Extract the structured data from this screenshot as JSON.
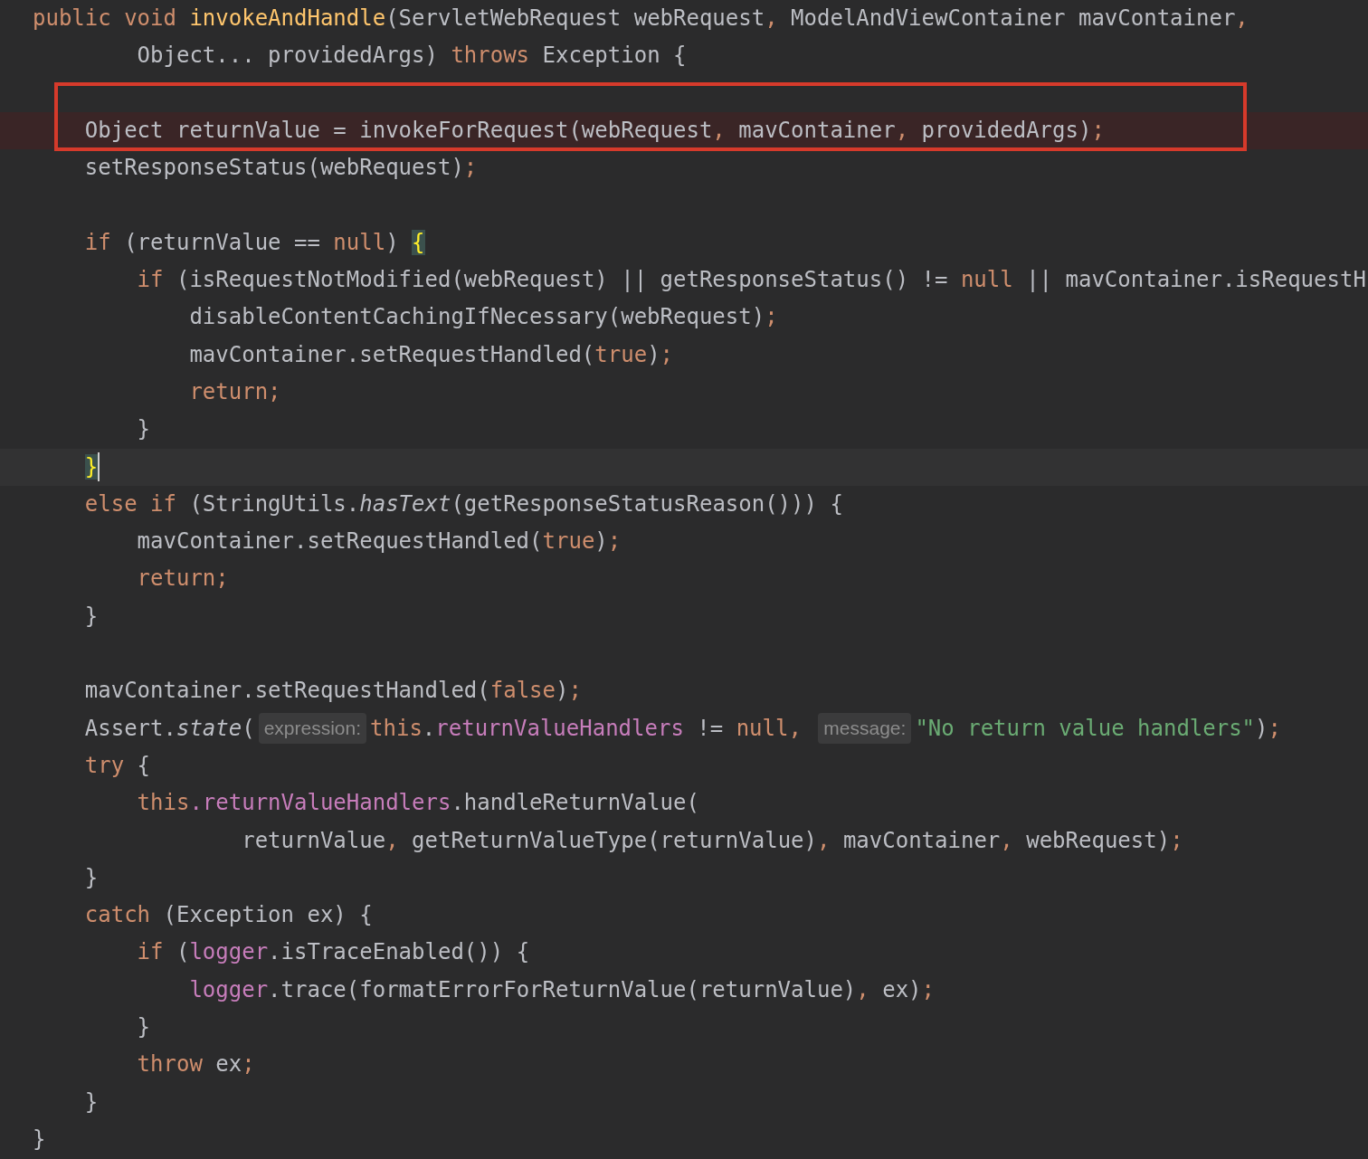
{
  "editor": {
    "lines": [
      {
        "kind": "code",
        "tokens": [
          {
            "kind": "kw",
            "text": "public void "
          },
          {
            "kind": "fn",
            "text": "invokeAndHandle"
          },
          {
            "kind": "plain",
            "text": "(ServletWebRequest webRequest"
          },
          {
            "kind": "punct",
            "text": ", "
          },
          {
            "kind": "plain",
            "text": "ModelAndViewContainer mavContainer"
          },
          {
            "kind": "punct",
            "text": ","
          }
        ],
        "children": [
          {
            "kind": "continuation",
            "tokens": [
              {
                "kind": "plain",
                "text": "Object... providedArgs) "
              },
              {
                "kind": "kw",
                "text": "throws "
              },
              {
                "kind": "plain",
                "text": "Exception {"
              }
            ]
          },
          {
            "kind": "blank",
            "boxed": true
          },
          {
            "kind": "code",
            "boxed": true,
            "breakpoint": true,
            "tokens": [
              {
                "kind": "plain",
                "text": "Object returnValue = invokeForRequest(webRequest"
              },
              {
                "kind": "punct",
                "text": ", "
              },
              {
                "kind": "plain",
                "text": "mavContainer"
              },
              {
                "kind": "punct",
                "text": ", "
              },
              {
                "kind": "plain",
                "text": "providedArgs)"
              },
              {
                "kind": "punct",
                "text": ";"
              }
            ]
          },
          {
            "kind": "code",
            "tokens": [
              {
                "kind": "plain",
                "text": "setResponseStatus(webRequest)"
              },
              {
                "kind": "punct",
                "text": ";"
              }
            ]
          },
          {
            "kind": "blank"
          },
          {
            "kind": "code",
            "tokens": [
              {
                "kind": "kw",
                "text": "if "
              },
              {
                "kind": "plain",
                "text": "(returnValue == "
              },
              {
                "kind": "kw",
                "text": "null"
              },
              {
                "kind": "plain",
                "text": ") "
              },
              {
                "kind": "brace",
                "text": "{"
              }
            ],
            "children": [
              {
                "kind": "code",
                "tokens": [
                  {
                    "kind": "kw",
                    "text": "if "
                  },
                  {
                    "kind": "plain",
                    "text": "(isRequestNotModified(webRequest) || getResponseStatus() != "
                  },
                  {
                    "kind": "kw",
                    "text": "null"
                  },
                  {
                    "kind": "plain",
                    "text": " || mavContainer.isRequestH"
                  }
                ],
                "children": [
                  {
                    "kind": "code",
                    "tokens": [
                      {
                        "kind": "plain",
                        "text": "disableContentCachingIfNecessary(webRequest)"
                      },
                      {
                        "kind": "punct",
                        "text": ";"
                      }
                    ]
                  },
                  {
                    "kind": "code",
                    "tokens": [
                      {
                        "kind": "plain",
                        "text": "mavContainer.setRequestHandled("
                      },
                      {
                        "kind": "kw",
                        "text": "true"
                      },
                      {
                        "kind": "plain",
                        "text": ")"
                      },
                      {
                        "kind": "punct",
                        "text": ";"
                      }
                    ]
                  },
                  {
                    "kind": "code",
                    "tokens": [
                      {
                        "kind": "kw",
                        "text": "return;"
                      }
                    ]
                  }
                ]
              },
              {
                "kind": "code",
                "tokens": [
                  {
                    "kind": "plain",
                    "text": "}"
                  }
                ]
              }
            ]
          },
          {
            "kind": "code",
            "current_line": true,
            "caret": true,
            "tokens": [
              {
                "kind": "brace",
                "text": "}"
              }
            ]
          },
          {
            "kind": "code",
            "tokens": [
              {
                "kind": "kw",
                "text": "else if "
              },
              {
                "kind": "plain",
                "text": "(StringUtils."
              },
              {
                "kind": "italic",
                "text": "hasText"
              },
              {
                "kind": "plain",
                "text": "(getResponseStatusReason())) {"
              }
            ],
            "children": [
              {
                "kind": "code",
                "tokens": [
                  {
                    "kind": "plain",
                    "text": "mavContainer.setRequestHandled("
                  },
                  {
                    "kind": "kw",
                    "text": "true"
                  },
                  {
                    "kind": "plain",
                    "text": ")"
                  },
                  {
                    "kind": "punct",
                    "text": ";"
                  }
                ]
              },
              {
                "kind": "code",
                "tokens": [
                  {
                    "kind": "kw",
                    "text": "return;"
                  }
                ]
              }
            ]
          },
          {
            "kind": "code",
            "tokens": [
              {
                "kind": "plain",
                "text": "}"
              }
            ]
          },
          {
            "kind": "blank"
          },
          {
            "kind": "code",
            "tokens": [
              {
                "kind": "plain",
                "text": "mavContainer.setRequestHandled("
              },
              {
                "kind": "kw",
                "text": "false"
              },
              {
                "kind": "plain",
                "text": ")"
              },
              {
                "kind": "punct",
                "text": ";"
              }
            ]
          },
          {
            "kind": "code",
            "tokens": [
              {
                "kind": "plain",
                "text": "Assert."
              },
              {
                "kind": "italic",
                "text": "state"
              },
              {
                "kind": "plain",
                "text": "("
              },
              {
                "kind": "hint",
                "text": "expression:"
              },
              {
                "kind": "kw",
                "text": "this"
              },
              {
                "kind": "plain",
                "text": "."
              },
              {
                "kind": "field",
                "text": "returnValueHandlers"
              },
              {
                "kind": "plain",
                "text": " != "
              },
              {
                "kind": "kw",
                "text": "null"
              },
              {
                "kind": "punct",
                "text": ", "
              },
              {
                "kind": "hint",
                "text": "message:"
              },
              {
                "kind": "str",
                "text": "\"No return value handlers\""
              },
              {
                "kind": "plain",
                "text": ")"
              },
              {
                "kind": "punct",
                "text": ";"
              }
            ]
          },
          {
            "kind": "code",
            "tokens": [
              {
                "kind": "kw",
                "text": "try "
              },
              {
                "kind": "plain",
                "text": "{"
              }
            ],
            "children": [
              {
                "kind": "code",
                "tokens": [
                  {
                    "kind": "kw",
                    "text": "this"
                  },
                  {
                    "kind": "field",
                    "text": ".returnValueHandlers"
                  },
                  {
                    "kind": "plain",
                    "text": ".handleReturnValue("
                  }
                ],
                "children": [
                  {
                    "kind": "continuation",
                    "tokens": [
                      {
                        "kind": "plain",
                        "text": "returnValue"
                      },
                      {
                        "kind": "punct",
                        "text": ", "
                      },
                      {
                        "kind": "plain",
                        "text": "getReturnValueType(returnValue)"
                      },
                      {
                        "kind": "punct",
                        "text": ", "
                      },
                      {
                        "kind": "plain",
                        "text": "mavContainer"
                      },
                      {
                        "kind": "punct",
                        "text": ", "
                      },
                      {
                        "kind": "plain",
                        "text": "webRequest)"
                      },
                      {
                        "kind": "punct",
                        "text": ";"
                      }
                    ]
                  }
                ]
              }
            ]
          },
          {
            "kind": "code",
            "tokens": [
              {
                "kind": "plain",
                "text": "}"
              }
            ]
          },
          {
            "kind": "code",
            "tokens": [
              {
                "kind": "kw",
                "text": "catch "
              },
              {
                "kind": "plain",
                "text": "(Exception ex) {"
              }
            ],
            "children": [
              {
                "kind": "code",
                "tokens": [
                  {
                    "kind": "kw",
                    "text": "if "
                  },
                  {
                    "kind": "plain",
                    "text": "("
                  },
                  {
                    "kind": "field",
                    "text": "logger"
                  },
                  {
                    "kind": "plain",
                    "text": ".isTraceEnabled()) {"
                  }
                ],
                "children": [
                  {
                    "kind": "code",
                    "tokens": [
                      {
                        "kind": "field",
                        "text": "logger"
                      },
                      {
                        "kind": "plain",
                        "text": ".trace(formatErrorForReturnValue(returnValue)"
                      },
                      {
                        "kind": "punct",
                        "text": ", "
                      },
                      {
                        "kind": "plain",
                        "text": "ex)"
                      },
                      {
                        "kind": "punct",
                        "text": ";"
                      }
                    ]
                  }
                ]
              },
              {
                "kind": "code",
                "tokens": [
                  {
                    "kind": "plain",
                    "text": "}"
                  }
                ]
              },
              {
                "kind": "code",
                "tokens": [
                  {
                    "kind": "kw",
                    "text": "throw "
                  },
                  {
                    "kind": "plain",
                    "text": "ex"
                  },
                  {
                    "kind": "punct",
                    "text": ";"
                  }
                ]
              }
            ]
          },
          {
            "kind": "code",
            "tokens": [
              {
                "kind": "plain",
                "text": "}"
              }
            ]
          }
        ]
      },
      {
        "kind": "code",
        "tokens": [
          {
            "kind": "plain",
            "text": "}"
          }
        ]
      }
    ]
  }
}
